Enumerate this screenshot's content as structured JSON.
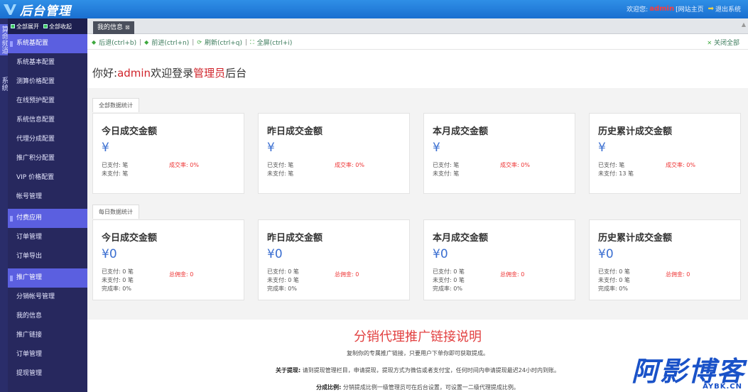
{
  "header": {
    "logo_text": "后台管理",
    "welcome_prefix": "欢迎您:",
    "username": "admin",
    "site_home": "[网站主页",
    "exit": "退出系统"
  },
  "leftstrip": {
    "tab_a": "算命频道",
    "tab_b": "系统"
  },
  "sidebar": {
    "expand_all": "全部展开",
    "collapse_all": "全部收起",
    "items": [
      {
        "label": "系统基配置",
        "group": true
      },
      {
        "label": "系统基本配置"
      },
      {
        "label": "测算价格配置"
      },
      {
        "label": "在线预护配置"
      },
      {
        "label": "系统信息配置"
      },
      {
        "label": "代理分成配置"
      },
      {
        "label": "推广积分配置"
      },
      {
        "label": "VIP 价格配置"
      },
      {
        "label": "帐号管理"
      },
      {
        "label": "付费应用",
        "group": true
      },
      {
        "label": "订单管理"
      },
      {
        "label": "订单导出"
      },
      {
        "label": "推广管理",
        "group": true
      },
      {
        "label": "分销帐号管理"
      },
      {
        "label": "我的信息"
      },
      {
        "label": "推广链接"
      },
      {
        "label": "订单管理"
      },
      {
        "label": "提现管理"
      }
    ]
  },
  "tabs": {
    "active": "我的信息"
  },
  "toolbar": {
    "back": "后退(ctrl+b)",
    "forward": "前进(ctrl+n)",
    "refresh": "刷新(ctrl+q)",
    "fullscreen": "全屏(ctrl+i)",
    "close_all": "关闭全部",
    "sep": "|"
  },
  "welcome": {
    "greeting": "你好:",
    "user": "admin",
    "mid": "欢迎登录",
    "role": "管理员",
    "suffix": "后台"
  },
  "sections": {
    "all": "全部数据统计",
    "daily": "每日数据统计"
  },
  "all_cards": [
    {
      "title": "今日成交金额",
      "amount": "¥",
      "paid": "已支付: 笔",
      "unpaid": "未支付: 笔",
      "rate_label": "成交率: 0%"
    },
    {
      "title": "昨日成交金额",
      "amount": "¥",
      "paid": "已支付: 笔",
      "unpaid": "未支付: 笔",
      "rate_label": "成交率: 0%"
    },
    {
      "title": "本月成交金额",
      "amount": "¥",
      "paid": "已支付: 笔",
      "unpaid": "未支付: 笔",
      "rate_label": "成交率: 0%"
    },
    {
      "title": "历史累计成交金额",
      "amount": "¥",
      "paid": "已支付: 笔",
      "unpaid": "未支付: 13 笔",
      "rate_label": "成交率: 0%"
    }
  ],
  "daily_cards": [
    {
      "title": "今日成交金额",
      "amount": "¥0",
      "paid": "已支付: 0 笔",
      "unpaid": "未支付: 0 笔",
      "done": "完成率: 0%",
      "commission": "总佣金: 0"
    },
    {
      "title": "昨日成交金额",
      "amount": "¥0",
      "paid": "已支付: 0 笔",
      "unpaid": "未支付: 0 笔",
      "done": "完成率: 0%",
      "commission": "总佣金: 0"
    },
    {
      "title": "本月成交金额",
      "amount": "¥0",
      "paid": "已支付: 0 笔",
      "unpaid": "未支付: 0 笔",
      "done": "完成率: 0%",
      "commission": "总佣金: 0"
    },
    {
      "title": "历史累计成交金额",
      "amount": "¥0",
      "paid": "已支付: 0 笔",
      "unpaid": "未支付: 0 笔",
      "done": "完成率: 0%",
      "commission": "总佣金: 0"
    }
  ],
  "promo": {
    "title": "分销代理推广链接说明",
    "line1": "复制你的专属推广链接，只要用户下单你即可获取提成。",
    "line2_label": "关于提现:",
    "line2": "请到提现管理栏目，申请提现，提现方式为微信或者支付宝，任何时间内申请提现最迟24小时内到账。",
    "line3_label": "分成比例:",
    "line3": "分销提成比例一级管理员可在后台设置，可设置一二级代理提成比例。"
  },
  "watermark": {
    "big": "阿影博客",
    "small": "AYBK.CN"
  },
  "colors": {
    "topbar": "#1a6fd0",
    "sidebar": "#27285e",
    "sidebar_group": "#5b5fe0",
    "accent_red": "#d0242b",
    "amount_blue": "#3b6fd1"
  }
}
